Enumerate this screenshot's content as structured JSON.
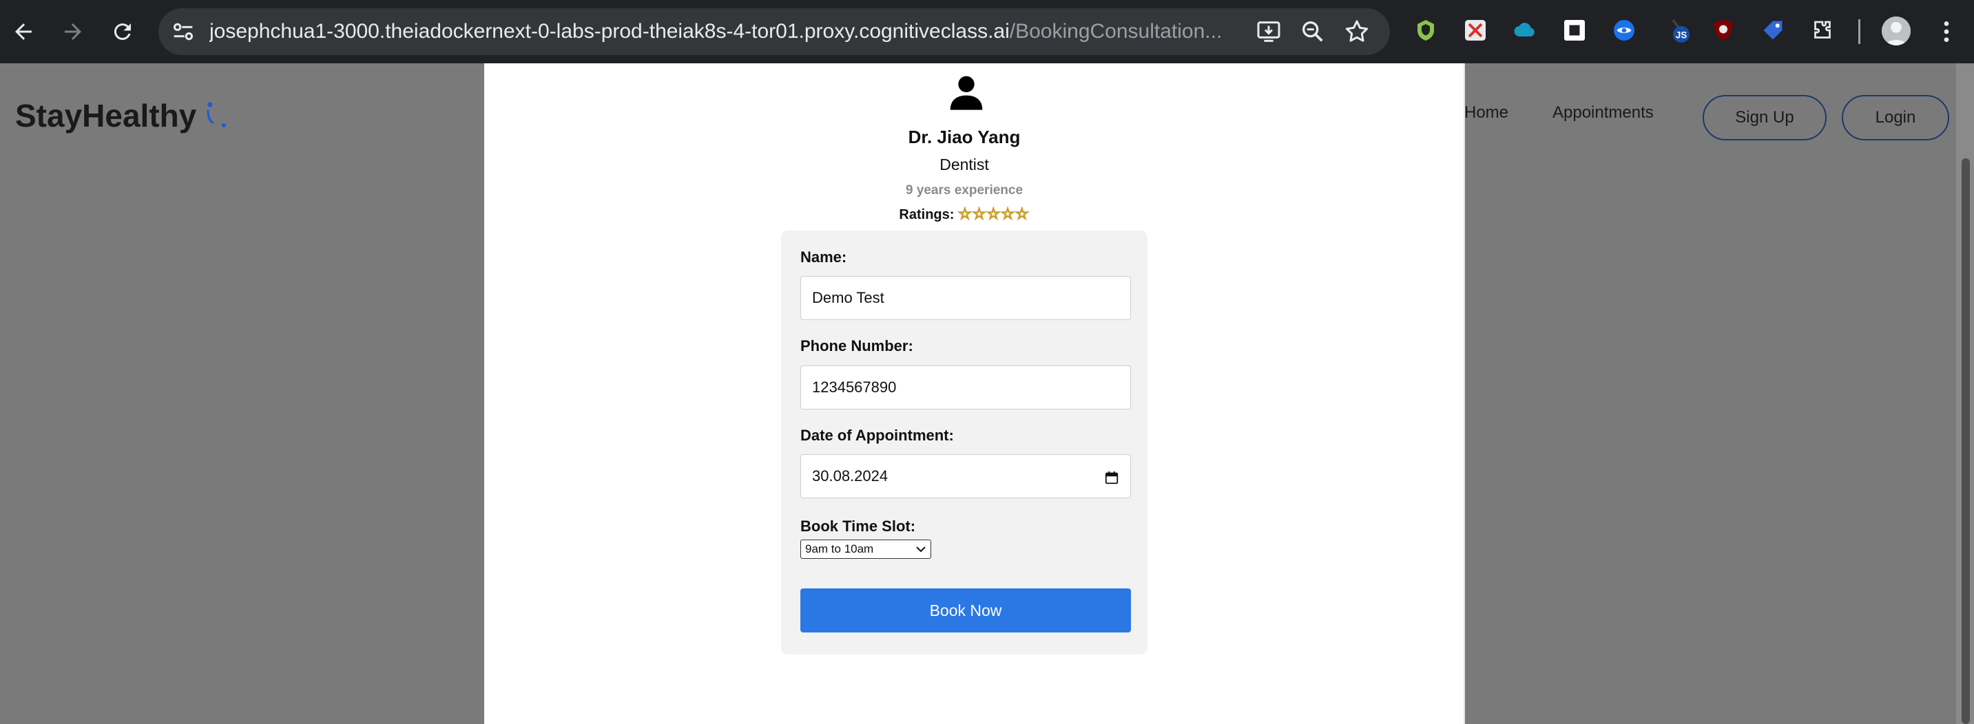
{
  "browser": {
    "url_host": "josephchua1-3000.theiadockernext-0-labs-prod-theiak8s-4-tor01.proxy.cognitiveclass.ai",
    "url_path": "/BookingConsultation..."
  },
  "extensions": {
    "js_badge": "JS"
  },
  "header": {
    "logo_text": "StayHealthy",
    "nav": {
      "home": "Home",
      "appointments": "Appointments",
      "signup": "Sign Up",
      "login": "Login"
    }
  },
  "doctor": {
    "name": "Dr. Jiao Yang",
    "specialty": "Dentist",
    "experience": "9 years experience",
    "ratings_label": "Ratings:",
    "stars": "☆☆☆☆☆"
  },
  "form": {
    "name_label": "Name:",
    "name_value": "Demo Test",
    "phone_label": "Phone Number:",
    "phone_value": "1234567890",
    "date_label": "Date of Appointment:",
    "date_value": "30.08.2024",
    "slot_label": "Book Time Slot:",
    "slot_value": "9am to 10am",
    "submit": "Book Now"
  },
  "colors": {
    "chrome_bg": "#202124",
    "overlay": "#7a7a7a",
    "primary_button": "#2b78e4",
    "star": "#f6c744"
  }
}
